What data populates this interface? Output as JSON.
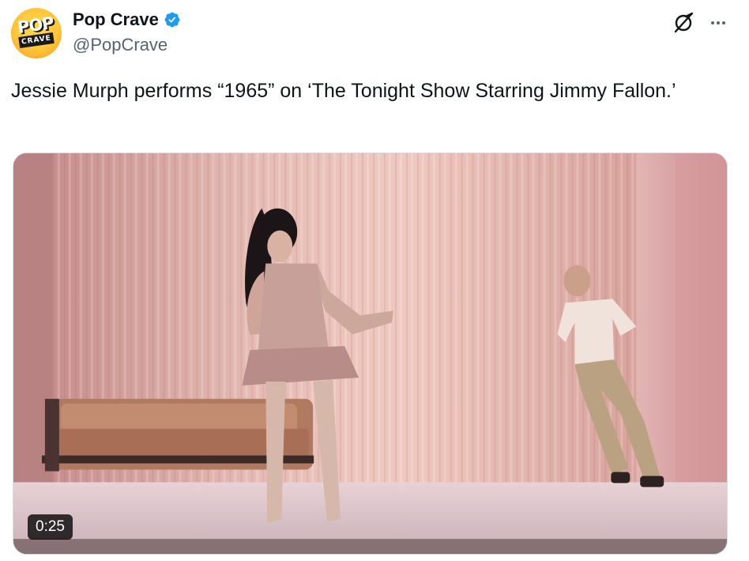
{
  "author": {
    "display_name": "Pop Crave",
    "handle": "@PopCrave",
    "verified": true,
    "avatar": {
      "logo_top": "POP",
      "logo_bottom": "CRAVE",
      "icon": "pop-crave-logo"
    }
  },
  "actions": {
    "grok_icon": "grok-icon",
    "more_icon": "more-icon"
  },
  "tweet": {
    "text": "Jessie Murph performs “1965” on ‘The Tonight Show Starring Jimmy Fallon.’"
  },
  "media": {
    "type": "video",
    "duration": "0:25",
    "description_icon": "video-thumbnail"
  },
  "colors": {
    "verified_blue": "#1d9bf0",
    "handle_gray": "#536471",
    "text": "#0f1419"
  }
}
